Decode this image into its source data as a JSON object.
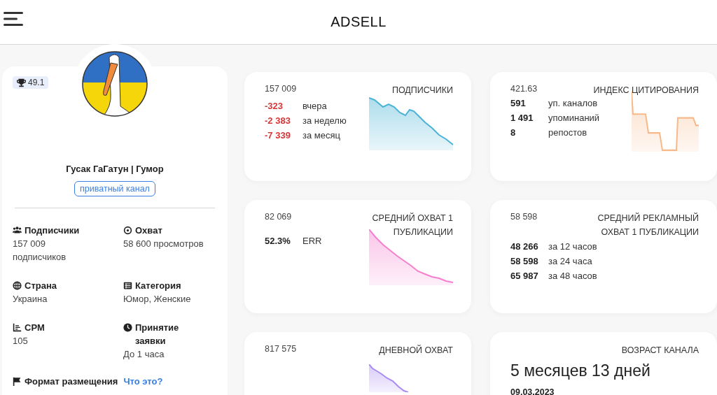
{
  "header": {
    "title": "ADSELL"
  },
  "channel": {
    "rating": "49.1",
    "name": "Гусак ГаГатун | Гумор",
    "tag": "приватный канал",
    "info": [
      {
        "label": "Подписчики",
        "value": "157 009 подписчиков"
      },
      {
        "label": "Охват",
        "value": "58 600 просмотров"
      },
      {
        "label": "Страна",
        "value": "Украина"
      },
      {
        "label": "Категория",
        "value": "Юмор, Женские"
      },
      {
        "label": "CPM",
        "value": "105"
      },
      {
        "label": "Принятие заявки",
        "value": "До 1 часа"
      }
    ],
    "format": {
      "label": "Формат размещения",
      "link": "Что это?"
    }
  },
  "cards": [
    {
      "kind": "stats",
      "value": "157 009",
      "title": "ПОДПИСЧИКИ",
      "color": "#4ab3d6",
      "stats": [
        {
          "value": "-323",
          "label": "вчера",
          "negative": true
        },
        {
          "value": "-2 383",
          "label": "за неделю",
          "negative": true
        },
        {
          "value": "-7 339",
          "label": "за месяц",
          "negative": true
        }
      ]
    },
    {
      "kind": "stats",
      "value": "421.63",
      "title": "ИНДЕКС ЦИТИРОВАНИЯ",
      "color": "#f8b98a",
      "stats": [
        {
          "value": "591",
          "label": "уп. каналов",
          "negative": false
        },
        {
          "value": "1 491",
          "label": "упоминаний",
          "negative": false
        },
        {
          "value": "8",
          "label": "репостов",
          "negative": false
        }
      ]
    },
    {
      "kind": "stats",
      "value": "82 069",
      "title": "СРЕДНИЙ ОХВАТ 1 ПУБЛИКАЦИИ",
      "color": "#f57fcf",
      "stats": [
        {
          "value": "52.3%",
          "label": "ERR",
          "negative": false
        }
      ]
    },
    {
      "kind": "stats",
      "value": "58 598",
      "title": "СРЕДНИЙ РЕКЛАМНЫЙ ОХВАТ 1 ПУБЛИКАЦИИ",
      "stats": [
        {
          "value": "48 266",
          "label": "за 12 часов",
          "negative": false
        },
        {
          "value": "58 598",
          "label": "за 24 часа",
          "negative": false
        },
        {
          "value": "65 987",
          "label": "за 48 часов",
          "negative": false
        }
      ]
    },
    {
      "kind": "stats",
      "value": "817 575",
      "title": "ДНЕВНОЙ ОХВАТ",
      "color": "#a98bf0"
    },
    {
      "kind": "age",
      "title": "ВОЗРАСТ КАНАЛА",
      "value": "5 месяцев 13 дней",
      "date": "09.03.2023"
    }
  ]
}
